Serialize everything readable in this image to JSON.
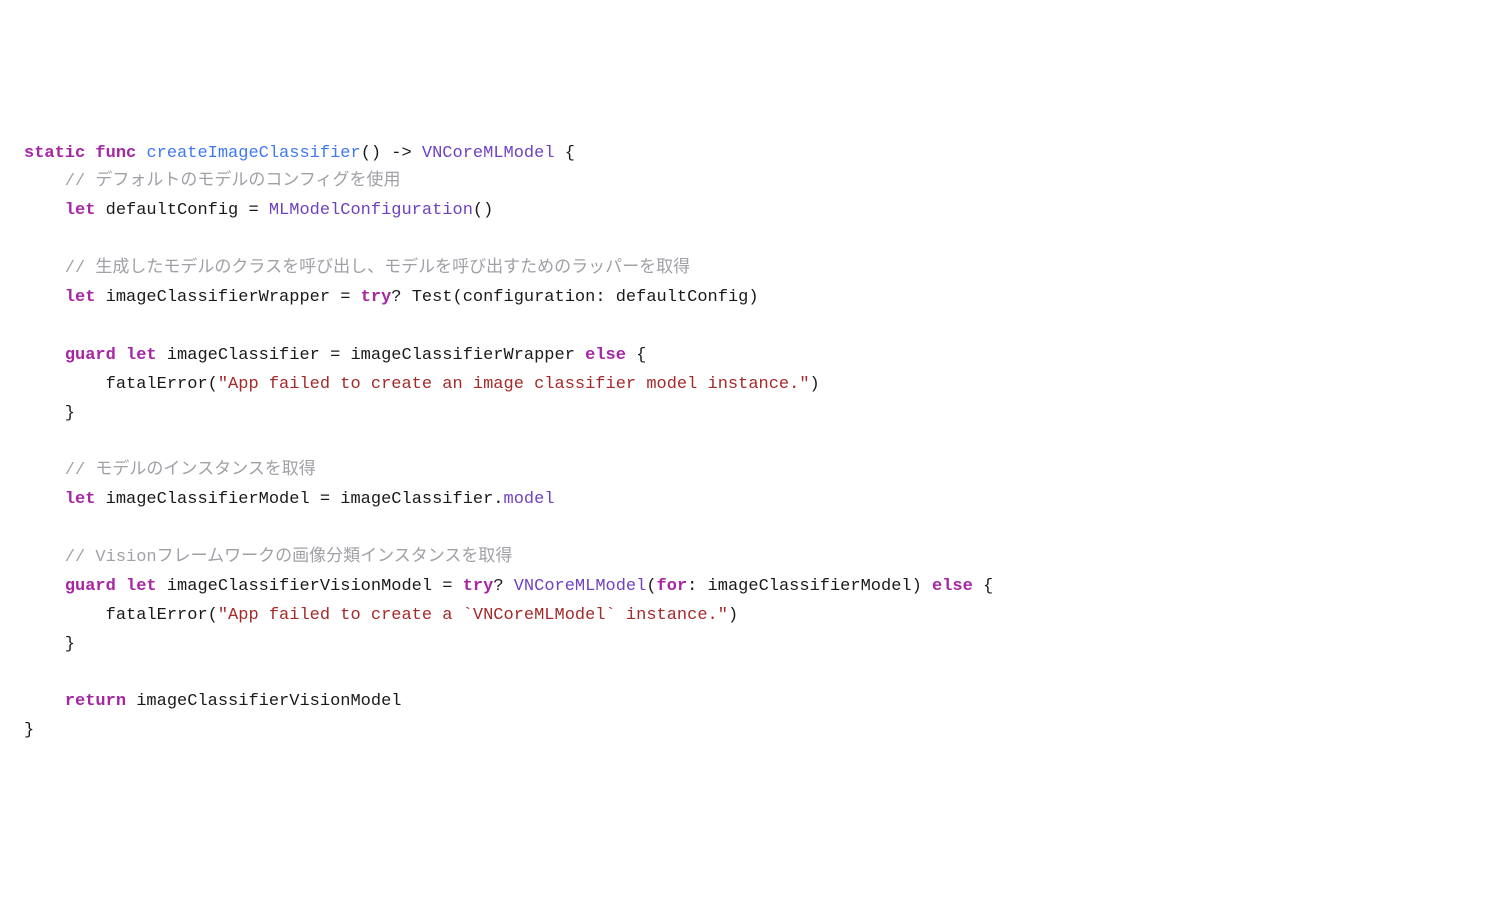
{
  "code": {
    "line1": {
      "static": "static",
      "func": "func",
      "name": "createImageClassifier",
      "parens": "()",
      "arrow": " -> ",
      "retType": "VNCoreMLModel",
      "brace": " {"
    },
    "comment1": "    // デフォルトのモデルのコンフィグを使用",
    "line2": {
      "indent": "    ",
      "let": "let",
      "sp": " ",
      "var": "defaultConfig",
      "eq": " = ",
      "type": "MLModelConfiguration",
      "parens": "()"
    },
    "comment2": "    // 生成したモデルのクラスを呼び出し、モデルを呼び出すためのラッパーを取得",
    "line3": {
      "indent": "    ",
      "let": "let",
      "sp": " ",
      "var": "imageClassifierWrapper",
      "eq": " = ",
      "try": "try",
      "q": "? ",
      "call": "Test(configuration: defaultConfig)"
    },
    "line4": {
      "indent": "    ",
      "guard": "guard",
      "sp1": " ",
      "let": "let",
      "sp2": " ",
      "var": "imageClassifier",
      "eq": " = imageClassifierWrapper ",
      "else": "else",
      "brace": " {"
    },
    "line5": {
      "indent": "        ",
      "call": "fatalError(",
      "str": "\"App failed to create an image classifier model instance.\"",
      "close": ")"
    },
    "line6": "    }",
    "comment3": "    // モデルのインスタンスを取得",
    "line7": {
      "indent": "    ",
      "let": "let",
      "sp": " ",
      "var": "imageClassifierModel",
      "eq": " = imageClassifier.",
      "prop": "model"
    },
    "comment4": "    // Visionフレームワークの画像分類インスタンスを取得",
    "line8": {
      "indent": "    ",
      "guard": "guard",
      "sp1": " ",
      "let": "let",
      "sp2": " ",
      "var": "imageClassifierVisionModel",
      "eq": " = ",
      "try": "try",
      "q": "? ",
      "type": "VNCoreMLModel",
      "open": "(",
      "for": "for",
      "arg": ": imageClassifierModel) ",
      "else": "else",
      "brace": " {"
    },
    "line9": {
      "indent": "        ",
      "call": "fatalError(",
      "str": "\"App failed to create a `VNCoreMLModel` instance.\"",
      "close": ")"
    },
    "line10": "    }",
    "line11": {
      "indent": "    ",
      "return": "return",
      "sp": " ",
      "var": "imageClassifierVisionModel"
    },
    "line12": "}"
  }
}
